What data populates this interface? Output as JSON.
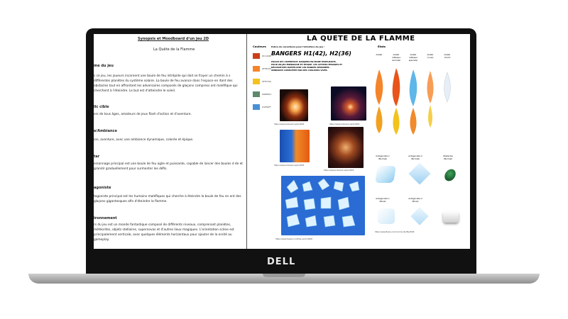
{
  "device": {
    "logo": "DELL"
  },
  "document": {
    "title": "Synopsis et Moodboard d'un jeu 2D",
    "subtitle": "La Quête de la Flamme",
    "sections": [
      {
        "heading": "me du jeu",
        "text": "s ce jeu, les joueurs incarnent une boule de feu intrépide qui doit se frayer un chemin à s différentes planètes du système solaire. La boule de feu avance dans l'espace en itant des obstacles tout en affrontant les adversaires composés de glaçons compress ant maléfique qui cherchent à l'éteindre. Le but est d'atteindre le soleil."
      },
      {
        "heading": "lic cible",
        "text": "ers de tous âges, amateurs de jeux flash d'action et d'aventure."
      },
      {
        "heading": "e/Ambiance",
        "text": "ion, aventure, avec une ambiance dynamique, colorée et épique."
      },
      {
        "heading": "tar",
        "text": "ersonnage principal est une boule de feu agile et puissante, capable de lancer des boules d de et grandir graduellement pour surmonter les défis."
      },
      {
        "heading": "agoniste",
        "text": "tagoniste principal est les humains maléfiques qui cherche à éteindre la boule de feu en ent des glaçons gigantesques afin d'éteindre la flamme."
      },
      {
        "heading": "ironnement",
        "text": "rs du jeu est un monde fantastique composé de différents niveaux, comprenant planètes, météorites, objets stellaires, supernovas et d'autres lieux magiques. L'orientation scène est principalement verticale, avec quelques éléments horizontaux pour ajouter de la ersité au gameplay."
      }
    ]
  },
  "board": {
    "title": "LA QUETE DE LA FLAMME",
    "colors_label": "Couleurs",
    "swatches": [
      {
        "label": "#C1440E",
        "color": "#c9401a"
      },
      {
        "label": "#FF8C00",
        "color": "#f5852a"
      },
      {
        "label": "#FFD700",
        "color": "#f3c21d"
      },
      {
        "label": "#6B8E23",
        "color": "#5d8a6a"
      },
      {
        "label": "#1E90FF",
        "color": "#4a8fd6"
      }
    ],
    "font_caption": "Police de caractères pour l'interface du jeu :",
    "font_sample": "BANGERS H1(42), H2(36)",
    "font_note": "POLICE DE L'INTERFACE: BANGERS EN MODE FANTAISISTE, POUR UN JEU ÉNERGIQUE ET ÉPIQUE. LES LETTRES ÉPAISSES ET DÉCORATIVES RAPPELLENT LES BANDES DESSINÉES. AMBIANCE COMPLÉTÉE PAR DES COULEURS VIVES.",
    "photo_urls": [
      "https://www.pinterest.ca/pin/###",
      "https://www.pinterest.ca/pin/###",
      "https://www.pinterest.ca/pin/###",
      "https://www.pinterest.ca/pin/###",
      "https://www.freepik.com/free-vector/###"
    ],
    "states_label": "États",
    "avatars": [
      {
        "label": "Avatar",
        "sub": ""
      },
      {
        "label": "Avatar",
        "sub": "(attaque normale)"
      },
      {
        "label": "Avatar",
        "sub": "(attaque spéciale)"
      },
      {
        "label": "Avatar",
        "sub": "(coup)"
      },
      {
        "label": "Avatar",
        "sub": "(mort)"
      }
    ],
    "enemies": [
      {
        "label": "Antagoniste 1",
        "sub": "(Normal)"
      },
      {
        "label": "Antagoniste 2",
        "sub": "(Normal)"
      },
      {
        "label": "Obstacles",
        "sub": "(Normal)"
      },
      {
        "label": "Antagoniste 1",
        "sub": "(Brisé)"
      },
      {
        "label": "Antagoniste 2",
        "sub": "(Brisé)"
      }
    ],
    "figma_url": "https://www.figma.com/community/file/###"
  }
}
